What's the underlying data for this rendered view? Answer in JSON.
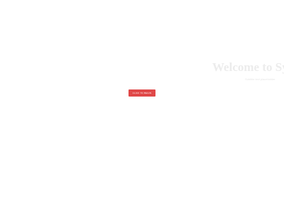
{
  "hero": {
    "title": "Welcome to Sy",
    "subtitle": "Subtitle text placeholder"
  },
  "cta": {
    "label": "CLICK TO BEGIN"
  },
  "colors": {
    "background": "#ffffff",
    "accent": "#e04848",
    "title_text": "#ececec",
    "subtitle_text": "#e6e6e6"
  }
}
